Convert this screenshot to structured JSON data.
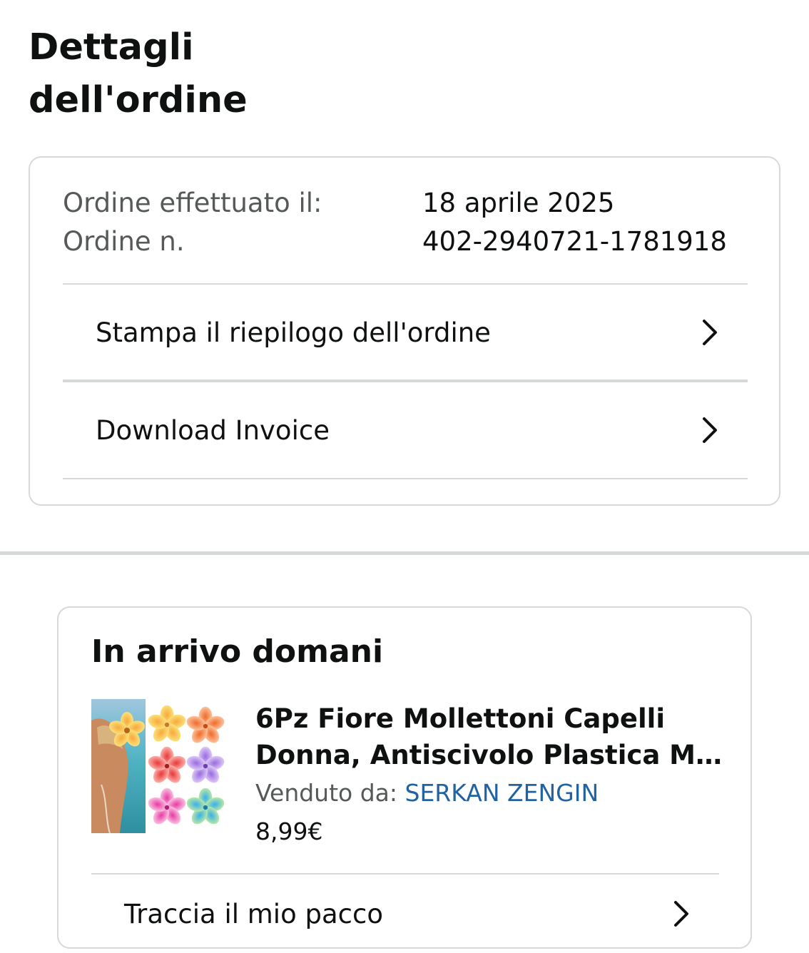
{
  "page": {
    "title_line1": "Dettagli",
    "title_line2": "dell'ordine"
  },
  "order_info": {
    "placed_label": "Ordine effettuato il:",
    "placed_value": "18 aprile 2025",
    "number_label": "Ordine n.",
    "number_value": "402-2940721-1781918"
  },
  "order_actions": [
    {
      "label": "Stampa il riepilogo dell'ordine",
      "icon": "chevron-right-icon"
    },
    {
      "label": "Download Invoice",
      "icon": "chevron-right-icon"
    }
  ],
  "shipment": {
    "status": "In arrivo domani",
    "product": {
      "title_line1": "6Pz Fiore Mollettoni Capelli",
      "title_line2": "Donna, Antiscivolo Plastica Moll...",
      "seller_label": "Venduto da:",
      "seller_name": "SERKAN ZENGIN",
      "price": "8,99€"
    },
    "track_label": "Traccia il mio pacco"
  },
  "colors": {
    "text": "#0f1111",
    "muted": "#565959",
    "link": "#2162a1",
    "border": "#d5d9d9"
  }
}
